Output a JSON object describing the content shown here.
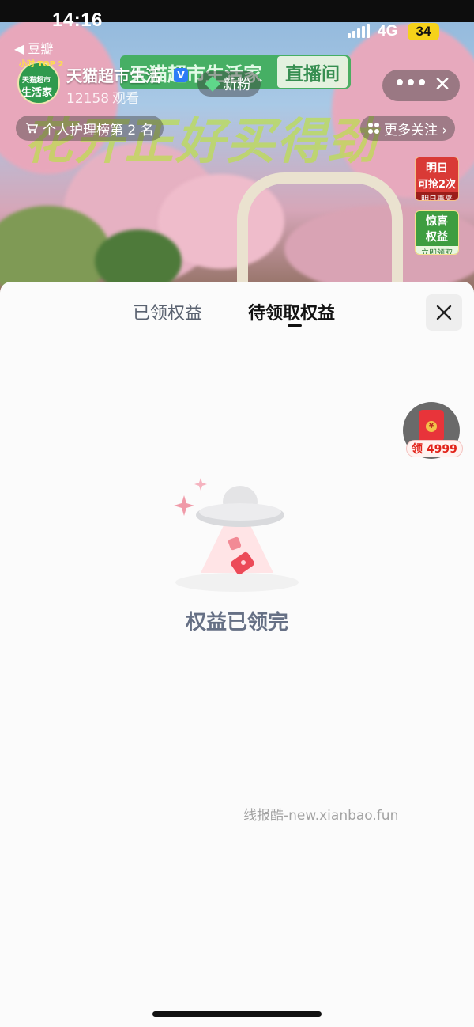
{
  "status_bar": {
    "time": "14:16",
    "network": "4G",
    "battery": "34",
    "back_app": "◀ 豆瓣"
  },
  "live_room": {
    "banner_left": "天猫超市生活家",
    "banner_right": "直播间",
    "slogan": "花开正好买得劲",
    "avatar_tag": "小时 TOP 2",
    "avatar_line1": "天猫超市",
    "avatar_line2": "生活家",
    "shop_name": "天猫超市生活",
    "verified_mark": "V",
    "new_fans_label": "新粉",
    "viewer_count": "12158",
    "viewer_unit": "观看",
    "more_label": "•••",
    "close_label": "✕",
    "rank_label": "个人护理榜第 2 名",
    "follow_label": "更多关注 ›",
    "promo_red": {
      "line1": "明日",
      "line2": "可抢2次",
      "line3": "明日再来"
    },
    "promo_green": {
      "line1": "惊喜",
      "line2": "权益",
      "line3": "立即领取"
    }
  },
  "sheet": {
    "tabs": [
      {
        "label": "已领权益",
        "active": false
      },
      {
        "label": "待领取权益",
        "active": true
      }
    ],
    "empty_text": "权益已领完",
    "red_packet_label": "领 4999",
    "red_packet_coin": "¥"
  },
  "watermark": "线报酷-new.xianbao.fun",
  "colors": {
    "accent_green": "#3fae5a",
    "red": "#e2231a",
    "empty_text": "#667085"
  }
}
